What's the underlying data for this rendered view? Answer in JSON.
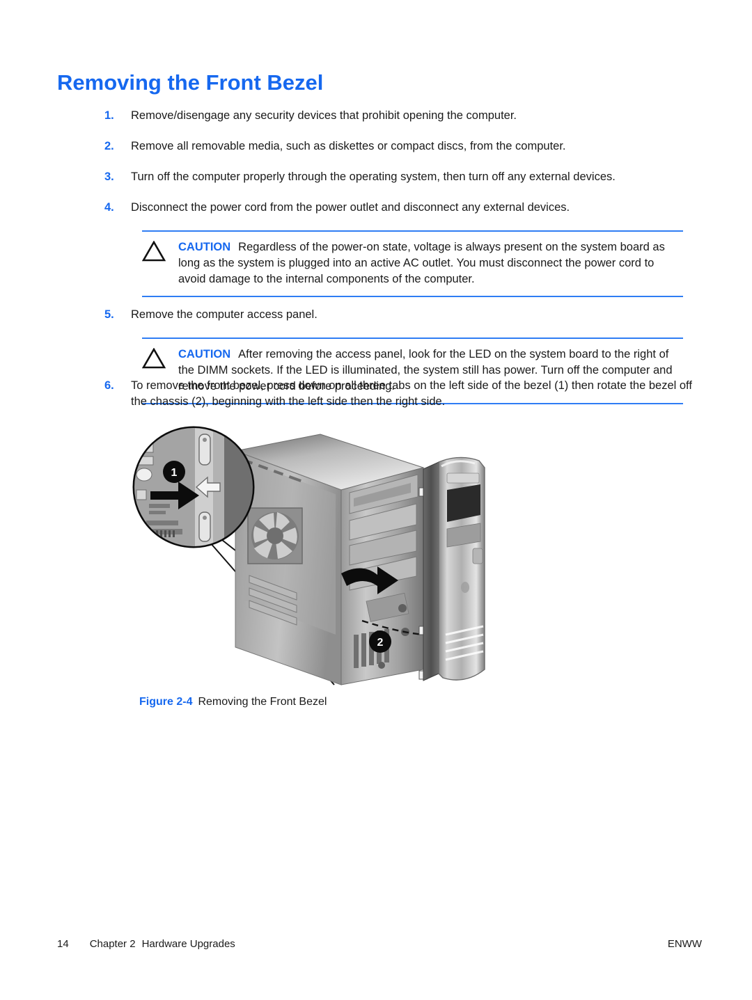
{
  "document": {
    "title": "Removing the Front Bezel"
  },
  "colors": {
    "accent_blue": "#1668ef",
    "rule_blue": "#2f7df4",
    "body_text": "#1a1a1a"
  },
  "steps": [
    {
      "num": "1.",
      "text": "Remove/disengage any security devices that prohibit opening the computer."
    },
    {
      "num": "2.",
      "text": "Remove all removable media, such as diskettes or compact discs, from the computer."
    },
    {
      "num": "3.",
      "text": "Turn off the computer properly through the operating system, then turn off any external devices."
    },
    {
      "num": "4.",
      "text": "Disconnect the power cord from the power outlet and disconnect any external devices."
    },
    {
      "num": "5.",
      "text": "Remove the computer access panel."
    },
    {
      "num": "6.",
      "text": "To remove the front bezel, press down on all three tabs on the left side of the bezel (1) then rotate the bezel off the chassis (2), beginning with the left side then the right side."
    }
  ],
  "cautions": [
    {
      "label": "CAUTION",
      "icon": "warning-triangle-icon",
      "text": "Regardless of the power-on state, voltage is always present on the system board as long as the system is plugged into an active AC outlet. You must disconnect the power cord to avoid damage to the internal components of the computer."
    },
    {
      "label": "CAUTION",
      "icon": "warning-triangle-icon",
      "text": "After removing the access panel, look for the LED on the system board to the right of the DIMM sockets. If the LED is illuminated, the system still has power. Turn off the computer and remove the power cord before proceeding."
    }
  ],
  "figure": {
    "label": "Figure 2-4",
    "caption": "Removing the Front Bezel",
    "callouts": [
      {
        "id": "1",
        "meaning": "press-down-on-bezel-tabs"
      },
      {
        "id": "2",
        "meaning": "rotate-bezel-off-chassis"
      }
    ],
    "alt": "Grayscale illustration of a computer tower chassis with the front bezel being rotated off, plus a circular magnified inset showing a bezel release tab being pressed."
  },
  "footer": {
    "page_number": "14",
    "chapter": "Chapter 2",
    "chapter_title": "Hardware Upgrades",
    "locale": "ENWW"
  }
}
